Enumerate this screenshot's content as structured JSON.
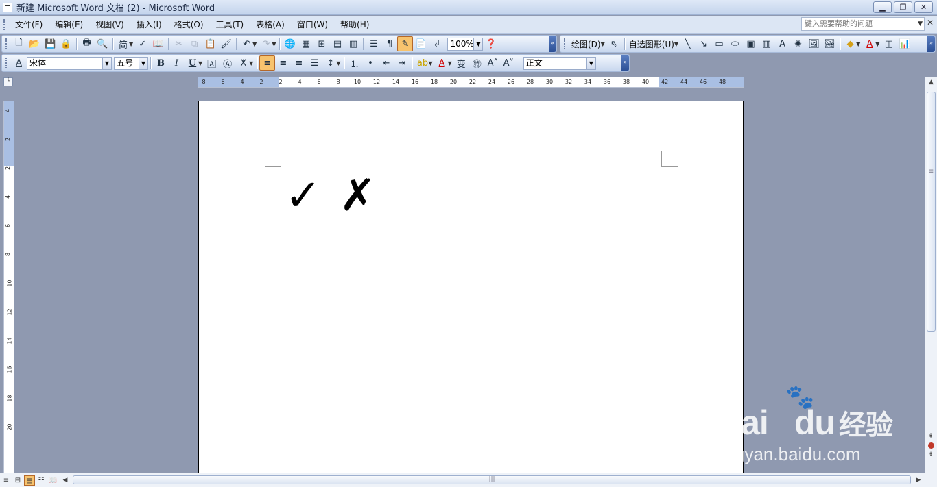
{
  "window": {
    "title": "新建 Microsoft Word 文档 (2) - Microsoft Word",
    "minimize": "▁",
    "restore": "❐",
    "close": "✕"
  },
  "menu": {
    "items": [
      "文件(F)",
      "编辑(E)",
      "视图(V)",
      "插入(I)",
      "格式(O)",
      "工具(T)",
      "表格(A)",
      "窗口(W)",
      "帮助(H)"
    ],
    "help_placeholder": "键入需要帮助的问题",
    "close_doc": "✕"
  },
  "toolbar_standard": {
    "convert_label": "简",
    "zoom": "100%"
  },
  "toolbar_drawing": {
    "draw_label": "绘图(D)",
    "autoshapes_label": "自选图形(U)"
  },
  "toolbar_format": {
    "font": "宋体",
    "size": "五号",
    "style": "正文",
    "bold": "B",
    "italic": "I",
    "underline": "U"
  },
  "ruler": {
    "horizontal": [
      "8",
      "6",
      "4",
      "2",
      "2",
      "4",
      "6",
      "8",
      "10",
      "12",
      "14",
      "16",
      "18",
      "20",
      "22",
      "24",
      "26",
      "28",
      "30",
      "32",
      "34",
      "36",
      "38",
      "40",
      "42",
      "44",
      "46",
      "48"
    ],
    "vertical": [
      "4",
      "2",
      "2",
      "4",
      "6",
      "8",
      "10",
      "12",
      "14",
      "16",
      "18",
      "20"
    ]
  },
  "document": {
    "content": "✓✗"
  },
  "watermark": {
    "brand": "Bai",
    "brand2": "du",
    "chinese": "经验",
    "url": "jingyan.baidu.com"
  },
  "colors": {
    "accent_selected": "#f7c36e",
    "workspace_bg": "#8f99b0",
    "toolbar_bg": "#dce6f4"
  }
}
